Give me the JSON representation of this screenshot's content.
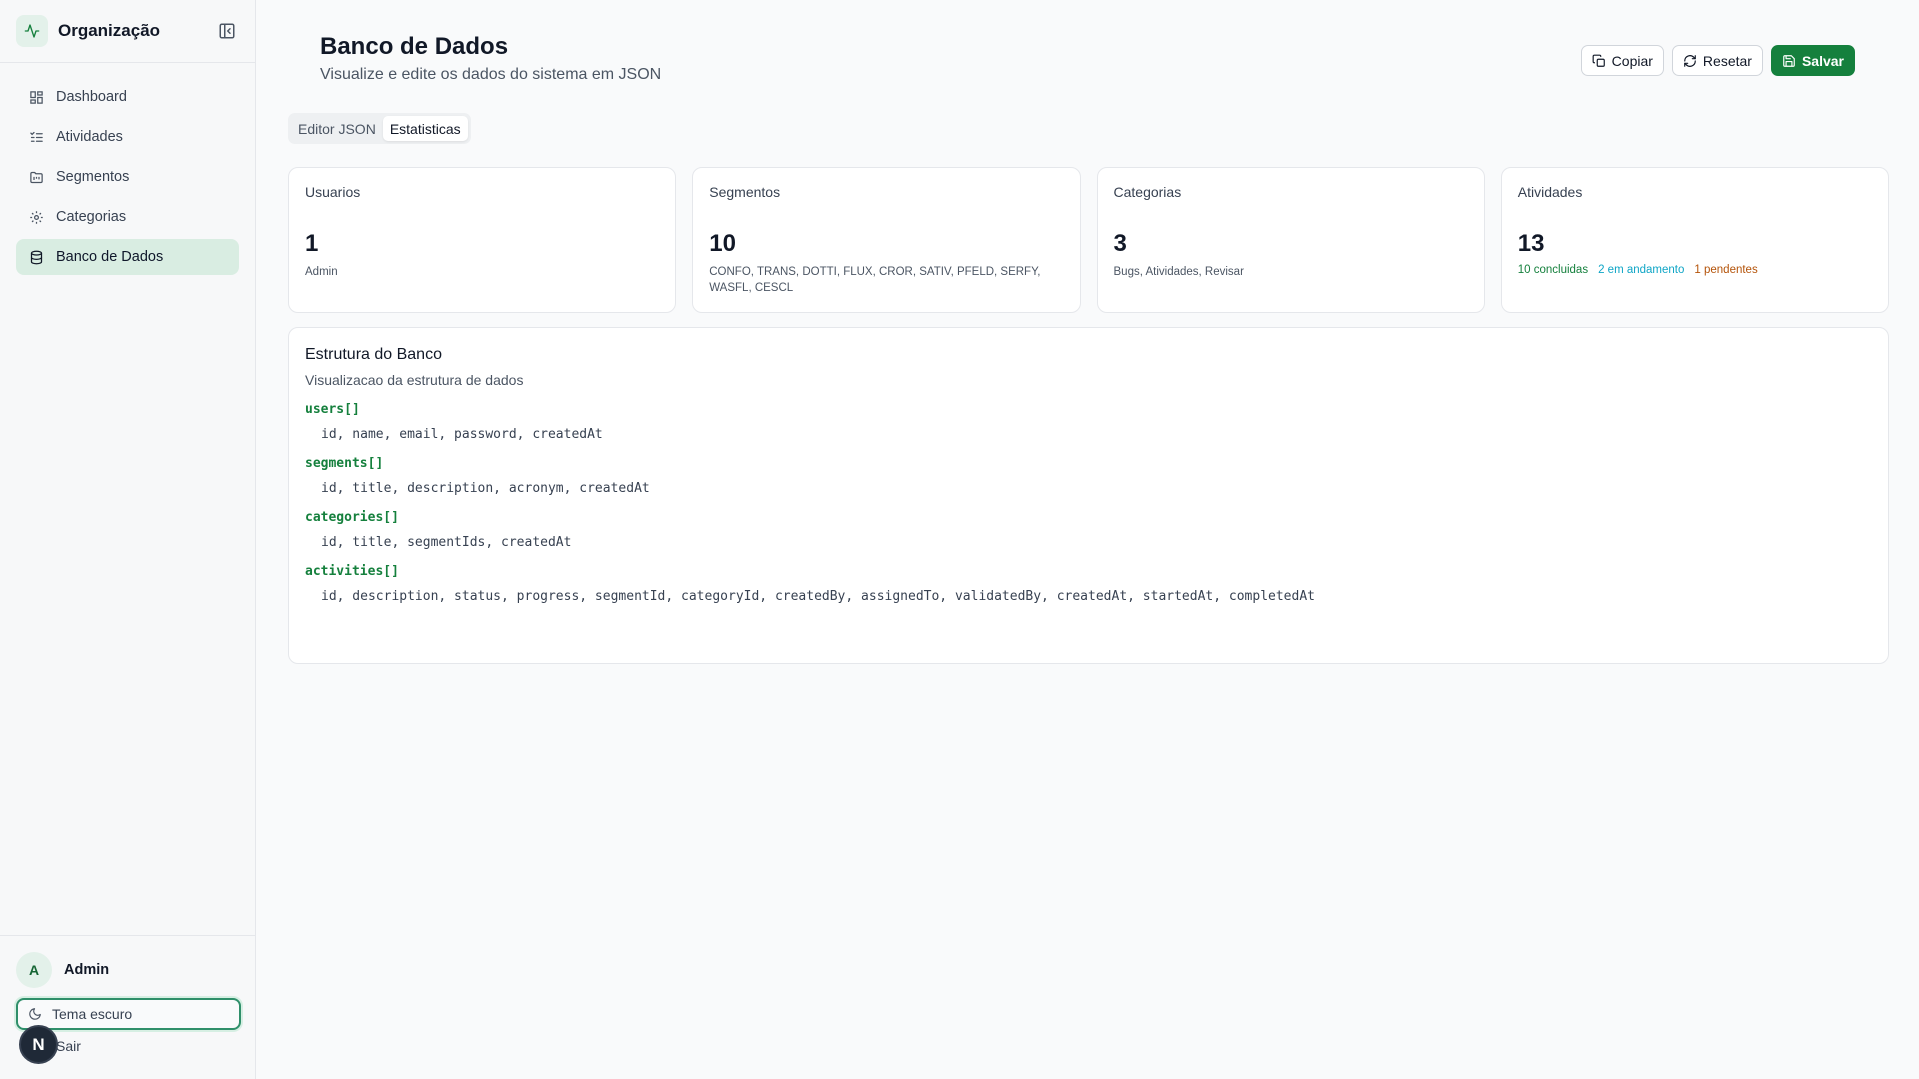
{
  "sidebar": {
    "brand": "Organização",
    "items": [
      {
        "label": "Dashboard",
        "icon": "grid-icon"
      },
      {
        "label": "Atividades",
        "icon": "list-check-icon"
      },
      {
        "label": "Segmentos",
        "icon": "folder-kanban-icon"
      },
      {
        "label": "Categorias",
        "icon": "gear-icon"
      },
      {
        "label": "Banco de Dados",
        "icon": "database-icon",
        "active": true
      }
    ],
    "user": {
      "initial": "A",
      "name": "Admin"
    },
    "theme_label": "Tema escuro",
    "logout_label": "Sair",
    "badge_letter": "N"
  },
  "header": {
    "title": "Banco de Dados",
    "subtitle": "Visualize e edite os dados do sistema em JSON",
    "actions": {
      "copy": "Copiar",
      "reset": "Resetar",
      "save": "Salvar"
    }
  },
  "tabs": [
    {
      "label": "Editor JSON",
      "active": false
    },
    {
      "label": "Estatisticas",
      "active": true
    }
  ],
  "stats": [
    {
      "label": "Usuarios",
      "value": "1",
      "desc": "Admin"
    },
    {
      "label": "Segmentos",
      "value": "10",
      "desc": "CONFO, TRANS, DOTTI, FLUX, CROR, SATIV, PFELD, SERFY, WASFL, CESCL"
    },
    {
      "label": "Categorias",
      "value": "3",
      "desc": "Bugs, Atividades, Revisar"
    },
    {
      "label": "Atividades",
      "value": "13",
      "status": {
        "done": "10 concluidas",
        "progress": "2 em andamento",
        "pending": "1 pendentes"
      }
    }
  ],
  "structure": {
    "title": "Estrutura do Banco",
    "subtitle": "Visualizacao da estrutura de dados",
    "entities": [
      {
        "name": "users[]",
        "fields": "id, name, email, password, createdAt"
      },
      {
        "name": "segments[]",
        "fields": "id, title, description, acronym, createdAt"
      },
      {
        "name": "categories[]",
        "fields": "id, title, segmentIds, createdAt"
      },
      {
        "name": "activities[]",
        "fields": "id, description, status, progress, segmentId, categoryId, createdBy, assignedTo, validatedBy, createdAt, startedAt, completedAt"
      }
    ]
  },
  "colors": {
    "accent": "#15803d",
    "active_bg": "#d9ede2",
    "progress": "#0ea5c6",
    "pending": "#b45309"
  }
}
